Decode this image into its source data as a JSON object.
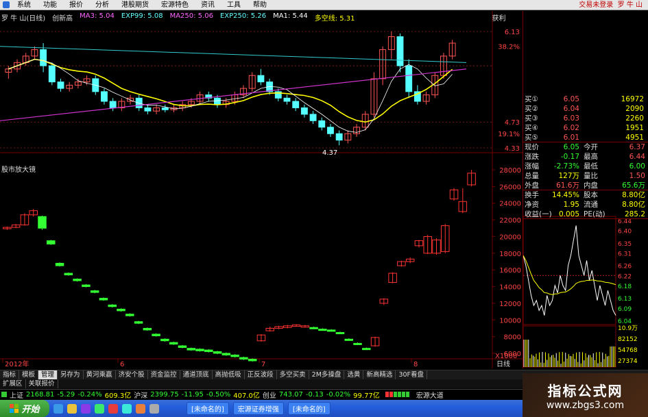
{
  "menu": {
    "items": [
      "系统",
      "功能",
      "报价",
      "分析",
      "港股期货",
      "宏源特色",
      "资讯",
      "工具",
      "帮助"
    ],
    "login_link": "交易未登录",
    "stock_short": "罗 牛 山"
  },
  "indicator": {
    "title": "罗 牛 山(日线)",
    "subtitle": "创新高",
    "ma3": "MA3: 5.04",
    "exp99": "EXP99: 5.08",
    "ma250": "MA250: 5.06",
    "exp250": "EXP250: 5.26",
    "ma1": "MA1: 5.44",
    "duokong": "多空线: 5.31",
    "profit": "获利",
    "low_mark": "4.37"
  },
  "lower_panel": {
    "title": "股市放大镜"
  },
  "upper_axis": [
    "6.13",
    "38.2%",
    "4.73",
    "19.1%",
    "4.33"
  ],
  "lower_axis": [
    "28000",
    "26000",
    "24000",
    "22000",
    "20000",
    "18000",
    "16000",
    "14000",
    "12000",
    "10000",
    "8000",
    "6000"
  ],
  "lower_axis_unit": "X1000",
  "x_axis": [
    "2012年",
    "6",
    "7",
    "8"
  ],
  "timeframe": "日线",
  "quotes": {
    "bids": [
      {
        "label": "买①",
        "price": "6.05",
        "vol": "16972"
      },
      {
        "label": "买②",
        "price": "6.04",
        "vol": "2090"
      },
      {
        "label": "买③",
        "price": "6.03",
        "vol": "2260"
      },
      {
        "label": "买④",
        "price": "6.02",
        "vol": "1951"
      },
      {
        "label": "买⑤",
        "price": "6.01",
        "vol": "4951"
      }
    ],
    "stats": [
      {
        "l1": "现价",
        "v1": "6.05",
        "l2": "今开",
        "v2": "6.37"
      },
      {
        "l1": "涨跌",
        "v1": "-0.17",
        "l2": "最高",
        "v2": "6.44"
      },
      {
        "l1": "涨幅",
        "v1": "-2.73%",
        "l2": "最低",
        "v2": "6.00"
      },
      {
        "l1": "总量",
        "v1": "127万",
        "l2": "量比",
        "v2": "1.50"
      },
      {
        "l1": "外盘",
        "v1": "61.6万",
        "l2": "内盘",
        "v2": "65.6万"
      },
      {
        "l1": "换手",
        "v1": "14.45%",
        "l2": "股本",
        "v2": "8.80亿"
      },
      {
        "l1": "净资",
        "v1": "1.95",
        "l2": "流通",
        "v2": "8.80亿"
      },
      {
        "l1": "收益(一)",
        "v1": "0.005",
        "l2": "PE(动)",
        "v2": "285.2"
      }
    ]
  },
  "intraday_axis": [
    "6.44",
    "6.40",
    "6.35",
    "6.31",
    "6.26",
    "6.22",
    "6.18",
    "6.13",
    "6.09",
    "6.04"
  ],
  "intraday_vol_axis": [
    "10.9万",
    "82152",
    "54768",
    "27374"
  ],
  "tabs_row1": [
    "指标",
    "模板",
    "管理",
    "另存为",
    "黄河乘赢",
    "济安个股",
    "资金监控",
    "通道顶底",
    "高抛低吸",
    "正反波段",
    "多空买卖",
    "2M多操盘",
    "选黄",
    "新高精选",
    "30F看盘"
  ],
  "tabs_row2": [
    "扩展区",
    "关联报价"
  ],
  "ticker": {
    "sh_label": "上证",
    "sh_value": "2168.81",
    "sh_change": "-5.29",
    "sh_pct": "-0.24%",
    "sh_amount": "609.3亿",
    "hs_label": "沪深",
    "hs_value": "2399.75",
    "hs_change": "-11.95",
    "hs_pct": "-0.50%",
    "hs_amount": "407.0亿",
    "cy_label": "创业",
    "cy_value": "743.07",
    "cy_change": "-0.13",
    "cy_pct": "-0.02%",
    "cy_amount": "99.77亿",
    "broker": "宏源大道"
  },
  "taskbar": {
    "start": "开始",
    "tasks": [
      "[未命名的]",
      "宏源证券增强",
      "[未命名的]"
    ]
  },
  "watermark": {
    "title": "指标公式网",
    "url": "www.zbgs3.com"
  },
  "colors": {
    "up": "#ff3333",
    "down": "#33cc33",
    "grid": "#7a0000",
    "yellow": "#ffff00",
    "cyan": "#00ffff",
    "magenta": "#ff00ff"
  },
  "chart_data": [
    {
      "type": "candlestick",
      "title": "罗 牛 山(日线)",
      "ylim": [
        4.33,
        6.13
      ],
      "ohlc": [
        [
          5.5,
          5.6,
          5.4,
          5.55
        ],
        [
          5.55,
          5.7,
          5.5,
          5.65
        ],
        [
          5.65,
          5.8,
          5.6,
          5.75
        ],
        [
          5.75,
          5.9,
          5.7,
          5.85
        ],
        [
          5.85,
          5.95,
          5.5,
          5.6
        ],
        [
          5.6,
          5.65,
          5.3,
          5.35
        ],
        [
          5.35,
          5.4,
          5.2,
          5.25
        ],
        [
          5.25,
          5.35,
          5.2,
          5.3
        ],
        [
          5.3,
          5.4,
          5.25,
          5.35
        ],
        [
          5.35,
          5.45,
          5.3,
          5.4
        ],
        [
          5.4,
          5.45,
          5.15,
          5.2
        ],
        [
          5.2,
          5.25,
          5.0,
          5.05
        ],
        [
          5.05,
          5.1,
          4.9,
          4.95
        ],
        [
          4.95,
          5.1,
          4.9,
          5.05
        ],
        [
          5.05,
          5.15,
          5.0,
          5.1
        ],
        [
          5.1,
          5.15,
          4.9,
          4.95
        ],
        [
          4.95,
          5.0,
          4.85,
          4.9
        ],
        [
          4.9,
          5.0,
          4.85,
          4.95
        ],
        [
          4.95,
          5.0,
          4.88,
          4.92
        ],
        [
          4.92,
          5.0,
          4.88,
          4.95
        ],
        [
          4.95,
          5.05,
          4.9,
          5.0
        ],
        [
          5.0,
          5.1,
          4.95,
          5.05
        ],
        [
          5.05,
          5.2,
          5.0,
          5.15
        ],
        [
          5.15,
          5.2,
          5.05,
          5.1
        ],
        [
          5.1,
          5.15,
          4.95,
          5.0
        ],
        [
          5.0,
          5.1,
          4.95,
          5.05
        ],
        [
          5.05,
          5.2,
          5.0,
          5.15
        ],
        [
          5.15,
          5.3,
          5.1,
          5.25
        ],
        [
          5.25,
          5.5,
          5.2,
          5.45
        ],
        [
          5.45,
          5.55,
          5.3,
          5.35
        ],
        [
          5.35,
          5.4,
          5.15,
          5.2
        ],
        [
          5.2,
          5.25,
          5.05,
          5.1
        ],
        [
          5.1,
          5.15,
          5.0,
          5.05
        ],
        [
          5.05,
          5.1,
          4.9,
          4.95
        ],
        [
          4.95,
          5.0,
          4.8,
          4.85
        ],
        [
          4.85,
          4.9,
          4.7,
          4.75
        ],
        [
          4.75,
          4.8,
          4.6,
          4.65
        ],
        [
          4.65,
          4.7,
          4.5,
          4.55
        ],
        [
          4.55,
          4.6,
          4.37,
          4.45
        ],
        [
          4.45,
          4.6,
          4.4,
          4.55
        ],
        [
          4.55,
          4.7,
          4.5,
          4.65
        ],
        [
          4.65,
          4.9,
          4.6,
          4.85
        ],
        [
          4.85,
          5.5,
          4.8,
          5.4
        ],
        [
          5.4,
          5.9,
          5.3,
          5.85
        ],
        [
          5.85,
          6.13,
          5.7,
          6.05
        ],
        [
          6.05,
          6.1,
          5.5,
          5.6
        ],
        [
          5.6,
          5.7,
          5.1,
          5.2
        ],
        [
          5.2,
          5.3,
          5.0,
          5.05
        ],
        [
          5.05,
          5.2,
          5.0,
          5.15
        ],
        [
          5.15,
          5.5,
          5.1,
          5.45
        ],
        [
          5.45,
          5.8,
          5.4,
          5.75
        ],
        [
          5.75,
          6.0,
          5.7,
          5.95
        ]
      ]
    },
    {
      "type": "candlestick",
      "title": "股市放大镜",
      "ylim": [
        6000,
        28000
      ],
      "ohlc": [
        [
          21000,
          21200,
          20800,
          21100
        ],
        [
          21100,
          21500,
          21000,
          21400
        ],
        [
          21400,
          22800,
          21300,
          22600
        ],
        [
          22600,
          23300,
          22400,
          23100
        ],
        [
          22400,
          22500,
          20800,
          21000
        ],
        [
          19500,
          19600,
          19000,
          19100
        ],
        [
          16800,
          16900,
          16400,
          16500
        ],
        [
          15600,
          15700,
          15300,
          15400
        ],
        [
          14900,
          15000,
          14600,
          14700
        ],
        [
          14200,
          14300,
          13900,
          14000
        ],
        [
          13500,
          13600,
          13200,
          13300
        ],
        [
          12600,
          12700,
          12300,
          12400
        ],
        [
          11800,
          11900,
          11500,
          11600
        ],
        [
          11300,
          11400,
          11000,
          11100
        ],
        [
          10700,
          10800,
          10400,
          10500
        ],
        [
          9800,
          9900,
          9500,
          9600
        ],
        [
          9000,
          9100,
          8700,
          8800
        ],
        [
          8300,
          8400,
          8000,
          8100
        ],
        [
          7700,
          7800,
          7400,
          7500
        ],
        [
          7300,
          7400,
          7000,
          7100
        ],
        [
          6900,
          7000,
          6600,
          6700
        ],
        [
          6600,
          6700,
          6300,
          6400
        ],
        [
          6500,
          6600,
          6200,
          6300
        ],
        [
          6400,
          6500,
          6100,
          6200
        ],
        [
          6200,
          6300,
          5900,
          6000
        ],
        [
          6000,
          6100,
          5700,
          5800
        ],
        [
          5800,
          5900,
          5500,
          5600
        ],
        [
          5500,
          5600,
          5200,
          5300
        ],
        [
          5300,
          5400,
          5000,
          5100
        ],
        [
          7500,
          8300,
          7400,
          8200
        ],
        [
          8700,
          9200,
          8600,
          9000
        ],
        [
          9000,
          9300,
          8900,
          9200
        ],
        [
          9100,
          9400,
          9000,
          9300
        ],
        [
          9300,
          9500,
          9200,
          9400
        ],
        [
          9200,
          9400,
          9100,
          9300
        ],
        [
          9100,
          9200,
          8900,
          9000
        ],
        [
          8900,
          9000,
          8700,
          8800
        ],
        [
          8800,
          8900,
          8600,
          8700
        ],
        [
          8500,
          8600,
          8300,
          8400
        ],
        [
          7700,
          7800,
          7500,
          7600
        ],
        [
          7200,
          7300,
          7000,
          7100
        ],
        [
          6600,
          6700,
          6400,
          6500
        ],
        [
          6900,
          8000,
          6800,
          7900
        ],
        [
          12000,
          12600,
          11800,
          12500
        ],
        [
          14500,
          15700,
          14400,
          15600
        ],
        [
          16500,
          17100,
          16400,
          17000
        ],
        [
          17000,
          17500,
          16800,
          17300
        ],
        [
          18900,
          19600,
          18700,
          19500
        ],
        [
          18000,
          20200,
          17900,
          20000
        ],
        [
          18000,
          19800,
          17800,
          19600
        ],
        [
          18200,
          21500,
          18000,
          21300
        ],
        [
          24500,
          25800,
          24300,
          25600
        ],
        [
          23000,
          25800,
          22800,
          24200
        ],
        [
          26200,
          28000,
          26000,
          27600
        ]
      ]
    }
  ]
}
